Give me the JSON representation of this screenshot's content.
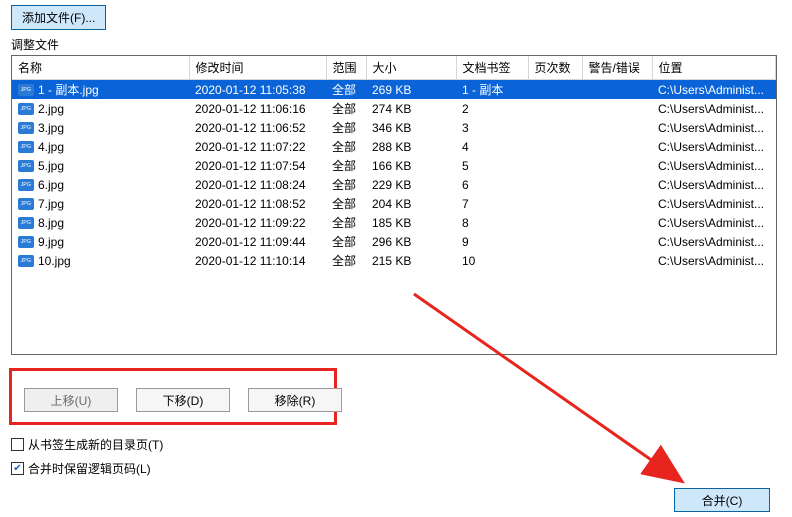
{
  "top_button_label": "添加文件(F)...",
  "section_label": "调整文件",
  "columns": {
    "name": "名称",
    "modified": "修改时间",
    "scope": "范围",
    "size": "大小",
    "bookmark": "文档书签",
    "pages": "页次数",
    "warnings": "警告/错误",
    "location": "位置"
  },
  "rows": [
    {
      "name": "1 - 副本.jpg",
      "modified": "2020-01-12 11:05:38",
      "scope": "全部",
      "size": "269 KB",
      "bookmark": "1 - 副本",
      "pages": "",
      "warnings": "",
      "location": "C:\\Users\\Administ...",
      "selected": true
    },
    {
      "name": "2.jpg",
      "modified": "2020-01-12 11:06:16",
      "scope": "全部",
      "size": "274 KB",
      "bookmark": "2",
      "pages": "",
      "warnings": "",
      "location": "C:\\Users\\Administ..."
    },
    {
      "name": "3.jpg",
      "modified": "2020-01-12 11:06:52",
      "scope": "全部",
      "size": "346 KB",
      "bookmark": "3",
      "pages": "",
      "warnings": "",
      "location": "C:\\Users\\Administ..."
    },
    {
      "name": "4.jpg",
      "modified": "2020-01-12 11:07:22",
      "scope": "全部",
      "size": "288 KB",
      "bookmark": "4",
      "pages": "",
      "warnings": "",
      "location": "C:\\Users\\Administ..."
    },
    {
      "name": "5.jpg",
      "modified": "2020-01-12 11:07:54",
      "scope": "全部",
      "size": "166 KB",
      "bookmark": "5",
      "pages": "",
      "warnings": "",
      "location": "C:\\Users\\Administ..."
    },
    {
      "name": "6.jpg",
      "modified": "2020-01-12 11:08:24",
      "scope": "全部",
      "size": "229 KB",
      "bookmark": "6",
      "pages": "",
      "warnings": "",
      "location": "C:\\Users\\Administ..."
    },
    {
      "name": "7.jpg",
      "modified": "2020-01-12 11:08:52",
      "scope": "全部",
      "size": "204 KB",
      "bookmark": "7",
      "pages": "",
      "warnings": "",
      "location": "C:\\Users\\Administ..."
    },
    {
      "name": "8.jpg",
      "modified": "2020-01-12 11:09:22",
      "scope": "全部",
      "size": "185 KB",
      "bookmark": "8",
      "pages": "",
      "warnings": "",
      "location": "C:\\Users\\Administ..."
    },
    {
      "name": "9.jpg",
      "modified": "2020-01-12 11:09:44",
      "scope": "全部",
      "size": "296 KB",
      "bookmark": "9",
      "pages": "",
      "warnings": "",
      "location": "C:\\Users\\Administ..."
    },
    {
      "name": "10.jpg",
      "modified": "2020-01-12 11:10:14",
      "scope": "全部",
      "size": "215 KB",
      "bookmark": "10",
      "pages": "",
      "warnings": "",
      "location": "C:\\Users\\Administ..."
    }
  ],
  "move_up_label": "上移(U)",
  "move_down_label": "下移(D)",
  "remove_label": "移除(R)",
  "checkbox1_label": "从书签生成新的目录页(T)",
  "checkbox1_checked": false,
  "checkbox2_label": "合并时保留逻辑页码(L)",
  "checkbox2_checked": true,
  "merge_button_label": "合并(C)"
}
